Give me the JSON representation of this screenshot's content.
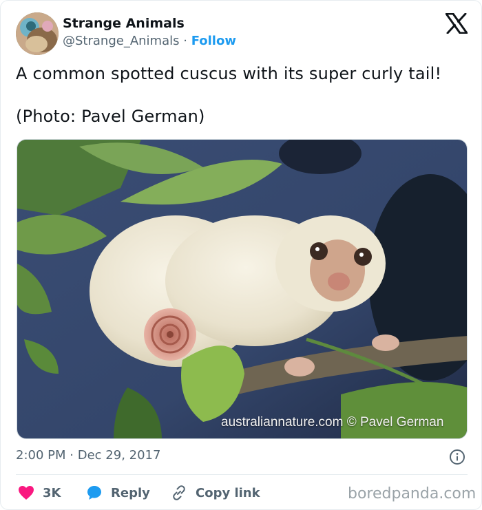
{
  "author": {
    "name": "Strange Animals",
    "handle": "@Strange_Animals",
    "separator": "·",
    "follow_label": "Follow"
  },
  "post": {
    "text_line1": "A common spotted cuscus with its super curly tail!",
    "text_line2": "(Photo: Pavel German)",
    "image_watermark": "australiannature.com © Pavel German",
    "time": "2:00 PM",
    "date_separator": "·",
    "date": "Dec 29, 2017"
  },
  "actions": {
    "like_count": "3K",
    "reply_label": "Reply",
    "copy_label": "Copy link"
  },
  "footer": {
    "credit": "boredpanda.com"
  },
  "colors": {
    "accent": "#1d9bf0",
    "like": "#f91880",
    "text": "#0f1419",
    "muted": "#536471"
  },
  "icons": [
    "x-logo-icon",
    "info-icon",
    "heart-icon",
    "reply-bubble-icon",
    "link-icon"
  ]
}
